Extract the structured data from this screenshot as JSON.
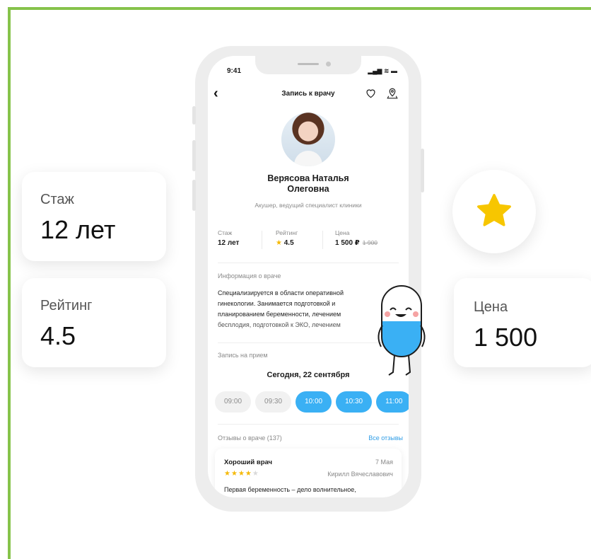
{
  "cards": {
    "stazh": {
      "label": "Стаж",
      "value": "12 лет"
    },
    "rating": {
      "label": "Рейтинг",
      "value": "4.5"
    },
    "price": {
      "label": "Цена",
      "value": "1 500"
    }
  },
  "status": {
    "time": "9:41",
    "icons": "▂▄▆ ≋ ▬"
  },
  "nav": {
    "back": "‹",
    "title": "Запись к врачу"
  },
  "doctor": {
    "name_line1": "Верясова Наталья",
    "name_line2": "Олеговна",
    "specialty": "Акушер, ведущий специалист клиники"
  },
  "stats": {
    "experience": {
      "label": "Стаж",
      "value": "12 лет"
    },
    "rating": {
      "label": "Рейтинг",
      "star": "★",
      "value": "4.5"
    },
    "price": {
      "label": "Цена",
      "value": "1 500 ₽",
      "old": "1 900"
    }
  },
  "info": {
    "title": "Информация о враче",
    "text_lines": [
      "Специализируется в области оперативной",
      "гинекологии. Занимается подготовкой и",
      "планированием беременности, лечением",
      "бесплодия, подготовкой к ЭКО, лечением"
    ]
  },
  "appointment": {
    "title": "Запись на прием",
    "date": "Сегодня, 22 сентября",
    "slots": [
      {
        "time": "09:00",
        "active": false
      },
      {
        "time": "09:30",
        "active": false
      },
      {
        "time": "10:00",
        "active": true
      },
      {
        "time": "10:30",
        "active": true
      },
      {
        "time": "11:00",
        "active": true
      }
    ]
  },
  "reviews": {
    "title": "Отзывы о враче (137)",
    "all_link": "Все отзывы",
    "items": [
      {
        "title": "Хороший врач",
        "date": "7 Мая",
        "stars": 4,
        "stars_max": 5,
        "author": "Кирилл Вячеславович",
        "text": "Первая беременность – дело волнительное,"
      }
    ]
  },
  "colors": {
    "accent": "#3ab0f4",
    "frame": "#86c34b",
    "star": "#f5b800"
  }
}
